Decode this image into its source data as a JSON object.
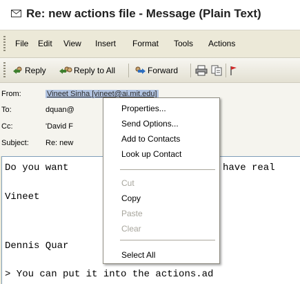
{
  "window": {
    "title": "Re: new actions file - Message (Plain Text)",
    "title_icon": "envelope-icon"
  },
  "menubar": {
    "items": [
      "File",
      "Edit",
      "View",
      "Insert",
      "Format",
      "Tools",
      "Actions"
    ]
  },
  "toolbar": {
    "reply": "Reply",
    "reply_all": "Reply to All",
    "forward": "Forward",
    "icons": [
      "reply-icon",
      "reply-all-icon",
      "forward-icon",
      "print-icon",
      "copy-icon",
      "flag-icon"
    ]
  },
  "header": {
    "from_label": "From:",
    "from_value": "Vineet Sinha [vineet@ai.mit.edu]",
    "to_label": "To:",
    "to_value": "dquan@",
    "cc_label": "Cc:",
    "cc_value": "'David F",
    "subject_label": "Subject:",
    "subject_value": "Re: new"
  },
  "body": {
    "line1_a": "Do you want",
    "line1_b": "have real",
    "line2": "Vineet",
    "line3": "Dennis Quar",
    "line4": "> You can put it into the actions.ad"
  },
  "context_menu": {
    "properties": "Properties...",
    "send_options": "Send Options...",
    "add_to_contacts": "Add to Contacts",
    "look_up_contact": "Look up Contact",
    "cut": "Cut",
    "copy": "Copy",
    "paste": "Paste",
    "clear": "Clear",
    "select_all": "Select All"
  },
  "colors": {
    "selection": "#b1c3e0",
    "menubar_bg": "#ece9d8",
    "disabled_text": "#a7a59c"
  }
}
